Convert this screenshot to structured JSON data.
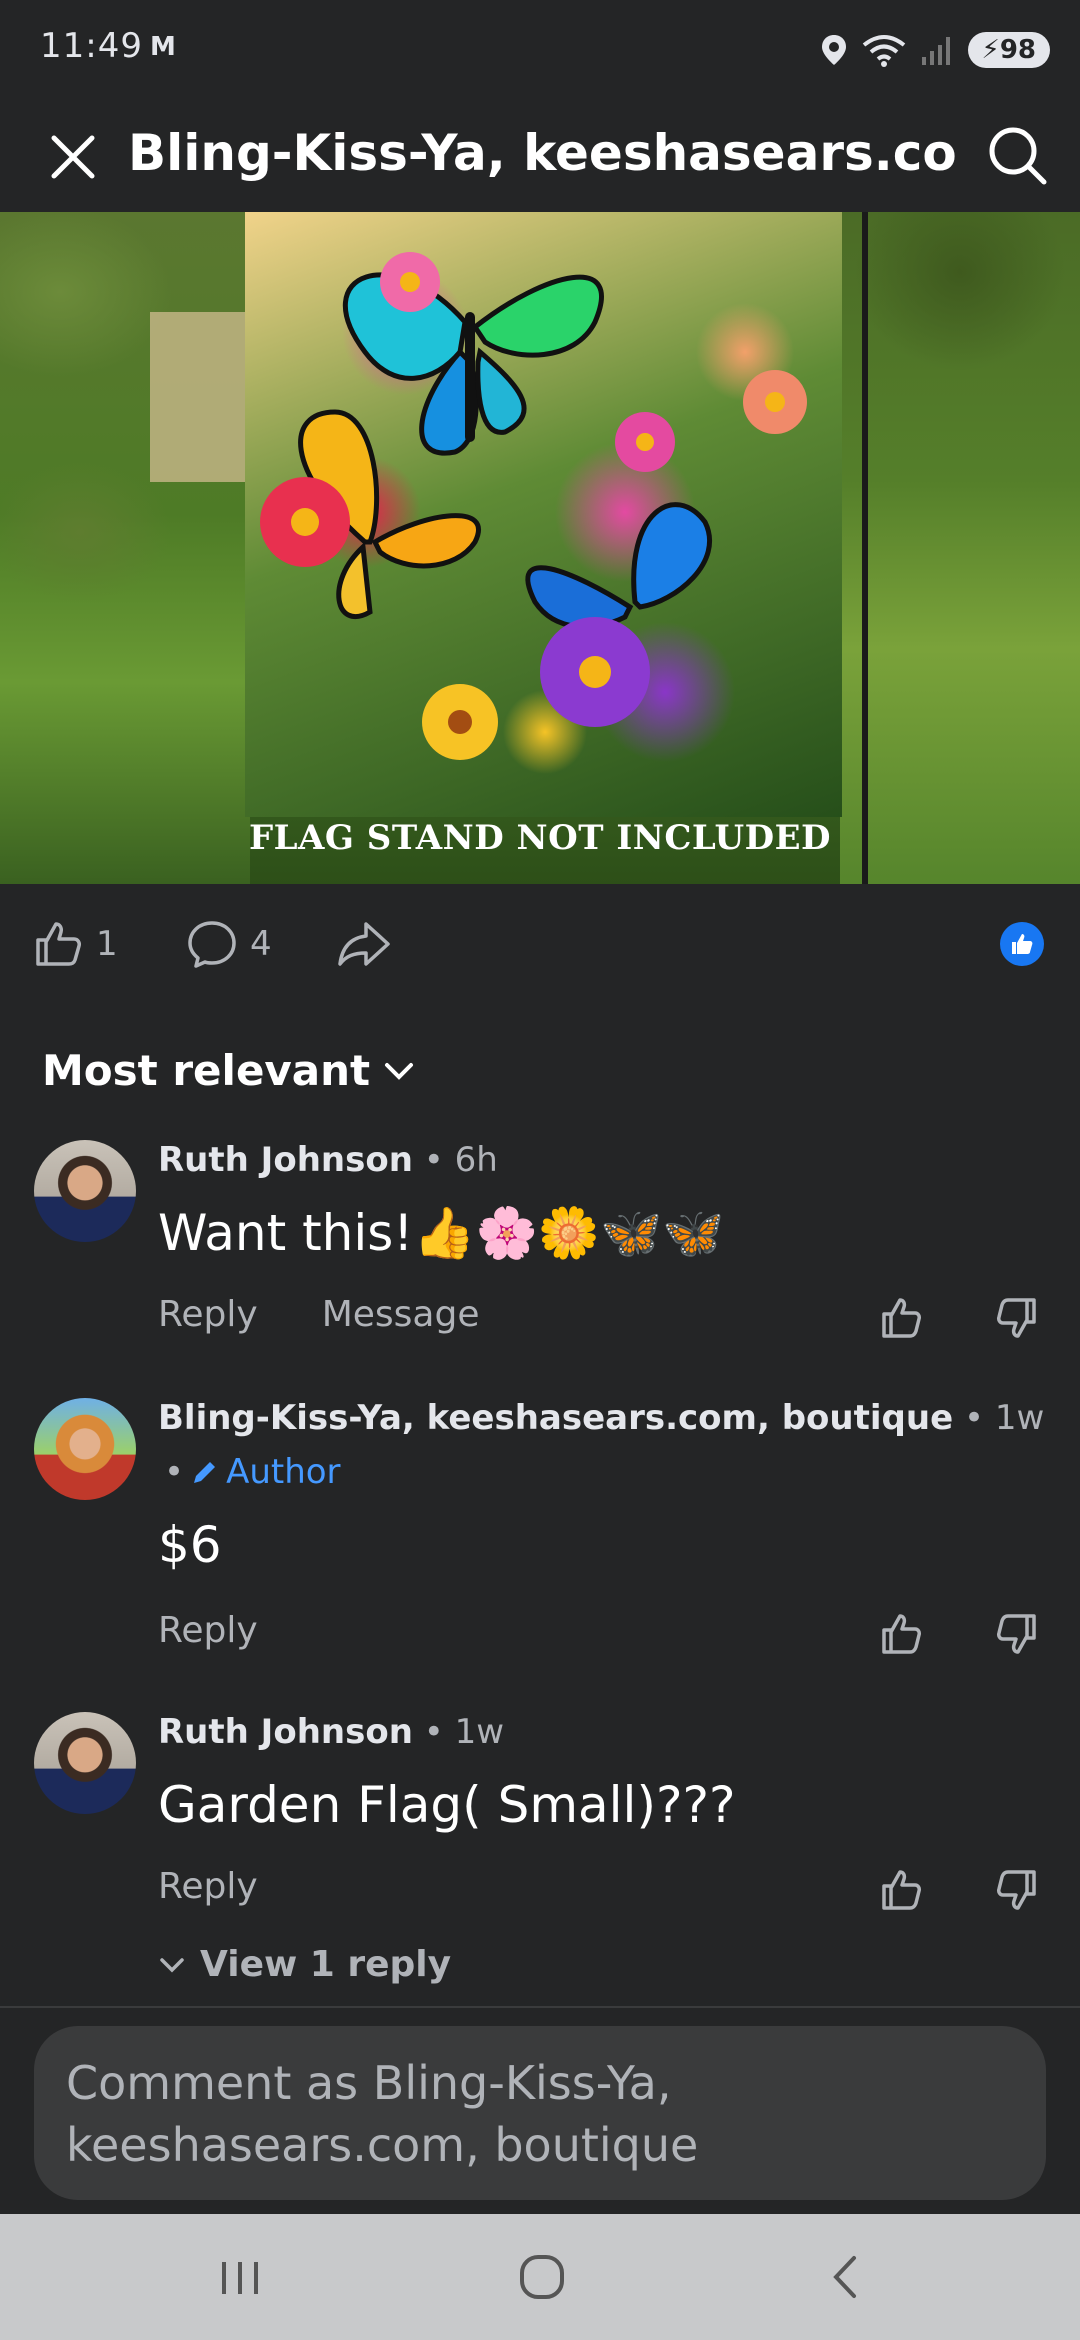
{
  "status_bar": {
    "time": "11:49",
    "carrier_icon": "M",
    "network": "6",
    "battery": "98"
  },
  "header": {
    "title": "Bling-Kiss-Ya, keeshasears.com,..."
  },
  "post": {
    "image_caption": "FLAG STAND NOT INCLUDED",
    "like_count": "1",
    "comment_count": "4"
  },
  "sort": {
    "label": "Most relevant"
  },
  "comments": [
    {
      "name": "Ruth Johnson",
      "time": "6h",
      "body": "Want this!👍🌸🌼🦋🦋",
      "reply": "Reply",
      "message": "Message"
    },
    {
      "name": "Bling-Kiss-Ya, keeshasears.com, boutique",
      "time": "1w",
      "badge": "Author",
      "body": "$6",
      "reply": "Reply"
    },
    {
      "name": "Ruth Johnson",
      "time": "1w",
      "body": "Garden Flag( Small)???",
      "reply": "Reply",
      "view_replies": "View 1 reply"
    }
  ],
  "composer": {
    "placeholder": "Comment as Bling-Kiss-Ya,\nkeeshasears.com, boutique"
  },
  "colors": {
    "background": "#242526",
    "accent": "#1877f2",
    "author": "#4599ff",
    "muted": "#b0b3b8"
  },
  "icons": [
    "close-icon",
    "search-icon",
    "like-icon",
    "comment-icon",
    "share-icon",
    "chevron-down-icon",
    "thumbs-up-icon",
    "thumbs-down-icon",
    "pencil-icon"
  ]
}
